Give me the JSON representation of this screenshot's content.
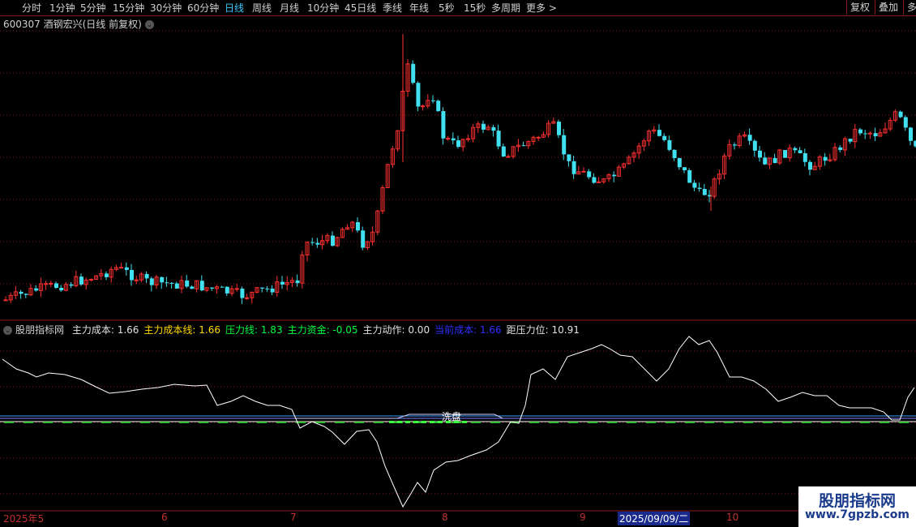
{
  "toolbar": {
    "periods": [
      "分时",
      "1分钟",
      "5分钟",
      "15分钟",
      "30分钟",
      "60分钟",
      "日线",
      "周线",
      "月线",
      "10分钟",
      "45日线",
      "季线",
      "年线",
      "5秒",
      "15秒",
      "多周期",
      "更多 >"
    ],
    "active": "日线",
    "right": [
      "复权",
      "叠加",
      "多"
    ]
  },
  "header": {
    "title": "600307 酒钢宏兴(日线 前复权)"
  },
  "indicator": {
    "name": "股朋指标网",
    "items": [
      {
        "label": "主力成本: 1.66",
        "color": "#e0e0e0"
      },
      {
        "label": "主力成本线: 1.66",
        "color": "#ffd700"
      },
      {
        "label": "压力线: 1.83",
        "color": "#00ff40"
      },
      {
        "label": "主力资金: -0.05",
        "color": "#00ff40"
      },
      {
        "label": "主力动作: 0.00",
        "color": "#e0e0e0"
      },
      {
        "label": "当前成本: 1.66",
        "color": "#3030ff"
      },
      {
        "label": "距压力位: 10.91",
        "color": "#e0e0e0"
      }
    ],
    "annotation": "洗盘"
  },
  "xaxis": {
    "labels": [
      "2025年5",
      "6",
      "7",
      "8",
      "9",
      "2025/09/09/二",
      "10"
    ],
    "selected": "2025/09/09/二"
  },
  "watermark": {
    "line1": "股朋指标网",
    "line2": "www.7gpzb.com"
  },
  "colors": {
    "up": "#ff3030",
    "down": "#40e0f0",
    "grid": "#8b1a1a",
    "line": "#ffffff"
  }
}
